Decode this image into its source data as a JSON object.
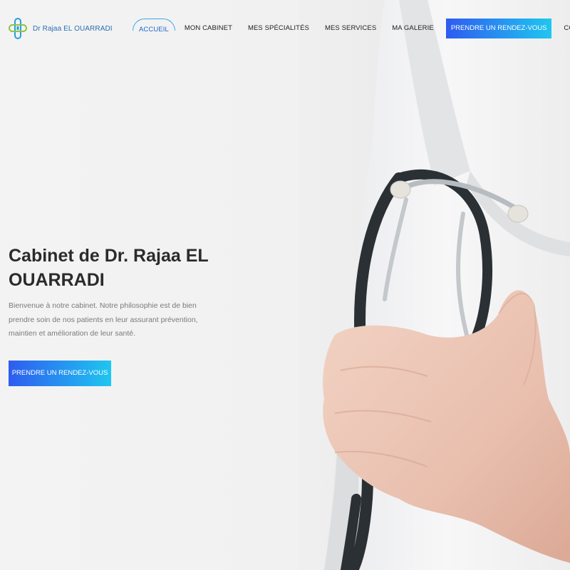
{
  "header": {
    "logo_text": "Dr Rajaa EL OUARRADI",
    "nav": [
      {
        "label": "ACCUEIL",
        "active": true
      },
      {
        "label": "MON CABINET"
      },
      {
        "label": "MES SPÉCIALITÉS"
      },
      {
        "label": "MES SERVICES"
      },
      {
        "label": "MA GALERIE"
      },
      {
        "label": "PRENDRE UN RENDEZ-VOUS",
        "cta": true
      },
      {
        "label": "CONTACTEZ-NOUS"
      }
    ]
  },
  "hero": {
    "title": "Cabinet de Dr. Rajaa EL OUARRADI",
    "text": "Bienvenue à notre cabinet. Notre philosophie est de bien prendre soin de nos patients en leur assurant prévention, maintien et amélioration de leur santé.",
    "button_label": "PRENDRE UN RENDEZ-VOUS",
    "image": "doctor-with-stethoscope"
  },
  "colors": {
    "accent_start": "#2e5cf0",
    "accent_end": "#1fc6f0",
    "logo_text": "#2a6fb3",
    "logo_green": "#8cc63f",
    "logo_blue": "#2a9de0"
  }
}
